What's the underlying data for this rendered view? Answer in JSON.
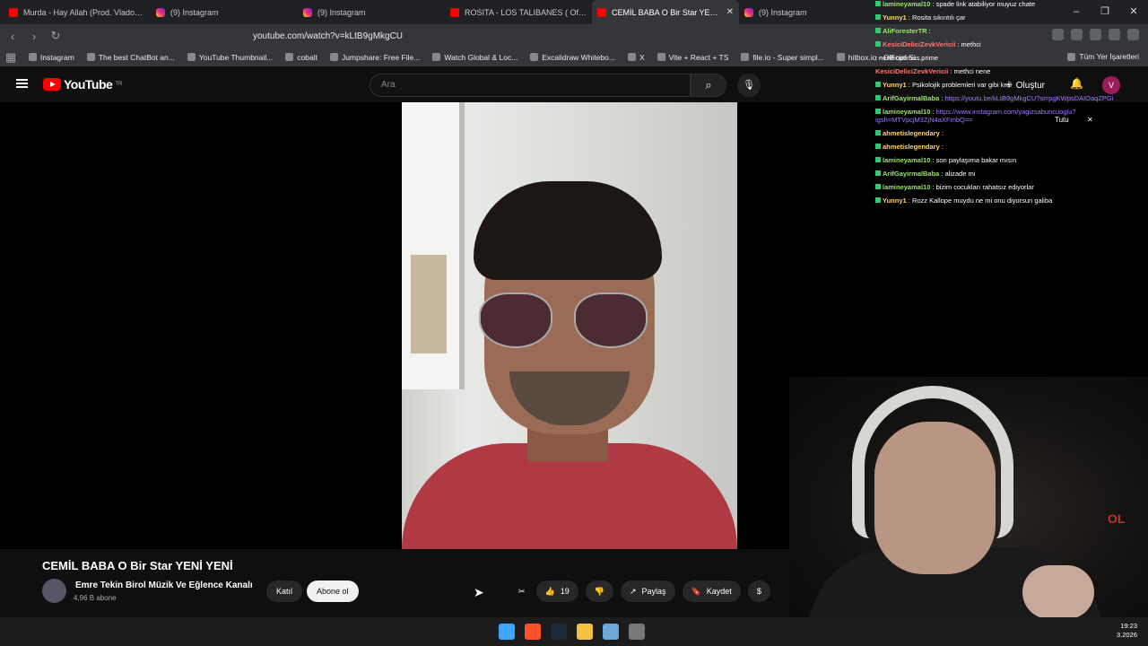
{
  "browser": {
    "tabs": [
      {
        "title": "Murda - Hay Allah (Prod. Vlado) - You",
        "icon": "youtube-icon",
        "active": false
      },
      {
        "title": "(9) Instagram",
        "icon": "instagram-icon",
        "active": false
      },
      {
        "title": "(9) Instagram",
        "icon": "instagram-icon",
        "active": false
      },
      {
        "title": "ROSITA - LOS TALIBANES ( Official M",
        "icon": "youtube-icon",
        "active": false
      },
      {
        "title": "CEMİL BABA O Bir Star YENİ Y",
        "icon": "youtube-icon",
        "active": true
      },
      {
        "title": "(9) Instagram",
        "icon": "instagram-icon",
        "active": false
      }
    ],
    "url": "youtube.com/watch?v=kLtB9gMkgCU",
    "bookmarks": [
      "Instagram",
      "The best ChatBot an...",
      "YouTube Thumbnail...",
      "cobalt",
      "Jumpshare: Free File...",
      "Watch Global & Loc...",
      "Excalidraw Whitebo...",
      "X",
      "Vite + React + TS",
      "file.io - Super simpl...",
      "hitbox.io - Official Si..."
    ],
    "bookmarks_more": "Tüm Yer İşaretleri"
  },
  "youtube": {
    "logo_text": "YouTube",
    "region": "TR",
    "search_placeholder": "Ara",
    "create_label": "Oluştur",
    "avatar_letter": "V",
    "video": {
      "title": "CEMİL BABA O Bir Star YENİ YENİ",
      "channel": "Emre Tekin Birol Müzik Ve Eğlence Kanalı",
      "subscribers": "4,96 B abone",
      "join_label": "Katıl",
      "subscribe_label": "Abone ol",
      "likes": "19",
      "share_label": "Paylaş",
      "save_label": "Kaydet"
    }
  },
  "chat": [
    {
      "user": "lamineyamal10",
      "msg": "spade link atabiliyor muyuz chate",
      "color": "g"
    },
    {
      "user": "Yunny1",
      "msg": "Rosita sıkıntılı çar",
      "color": "y"
    },
    {
      "user": "AliForesterTR",
      "msg": "",
      "color": "g"
    },
    {
      "user": "KesiciDeliciZevkVericii",
      "msg": "methci",
      "color": "r"
    },
    {
      "user": "",
      "msg": "nene optimus prime",
      "color": "y"
    },
    {
      "user": "KesiciDeliciZevkVericii",
      "msg": "methci nene",
      "color": "r"
    },
    {
      "user": "Yunny1",
      "msg": "Psikolojik problemleri var gibi kral",
      "color": "y"
    },
    {
      "user": "ArifGayirmalBaba",
      "msg": "https://youtu.be/kLtB9gMkgCU?si=pgKWpsDAIOaqZPGi",
      "color": "g",
      "link": true
    },
    {
      "user": "lamineyamal10",
      "msg": "https://www.instagram.com/yagizsabuncuoglu?igsh=MTVpcjM3ZjN4aXFmbQ==",
      "color": "g",
      "link": true
    },
    {
      "user": "ahmetislegendary",
      "msg": "",
      "color": "y"
    },
    {
      "user": "ahmetislegendary",
      "msg": "",
      "color": "y"
    },
    {
      "user": "lamineyamal10",
      "msg": "son paylaşıma bakar mısın",
      "color": "g"
    },
    {
      "user": "ArifGayirmalBaba",
      "msg": "alizade mi",
      "color": "g"
    },
    {
      "user": "lamineyamal10",
      "msg": "bizim cocukları rahatsız ediyorlar",
      "color": "g"
    },
    {
      "user": "Yunny1",
      "msg": "Rozz Kallope muydu ne mi onu diyorsun galiba",
      "color": "y"
    }
  ],
  "chat_popup_user": "Tutu",
  "overlay_logo": "OL",
  "taskbar": {
    "time": "19:23",
    "date": "3.2026"
  }
}
